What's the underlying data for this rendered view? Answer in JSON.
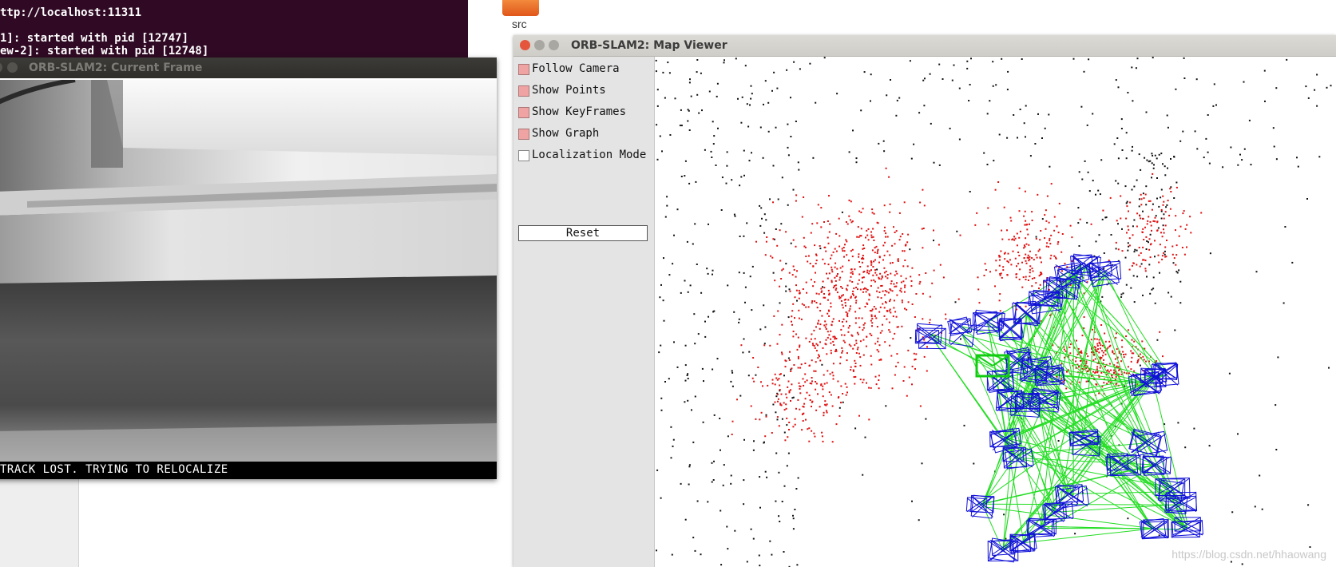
{
  "terminal": {
    "lines": [
      "ttp://localhost:11311",
      "",
      "1]: started with pid [12747]",
      "ew-2]: started with pid [12748]"
    ]
  },
  "desktop": {
    "folder_label": "src"
  },
  "current_frame": {
    "title": "ORB-SLAM2: Current Frame",
    "status": "TRACK LOST. TRYING TO RELOCALIZE"
  },
  "map_viewer": {
    "title": "ORB-SLAM2: Map Viewer",
    "options": [
      {
        "label": "Follow Camera",
        "checked": true
      },
      {
        "label": "Show Points",
        "checked": true
      },
      {
        "label": "Show KeyFrames",
        "checked": true
      },
      {
        "label": "Show Graph",
        "checked": true
      },
      {
        "label": "Localization Mode",
        "checked": false
      }
    ],
    "reset_label": "Reset",
    "watermark": "https://blog.csdn.net/hhaowang"
  },
  "colors": {
    "terminal_bg": "#300a24",
    "map_point_black": "#111111",
    "map_point_red": "#e01010",
    "keyframe_blue": "#1010d8",
    "graph_green": "#22dd22",
    "current_camera_green": "#11cc11",
    "checkbox_on": "#f0a3a3",
    "close_button": "#e5553c"
  },
  "icons": [
    "close-icon",
    "minimize-icon",
    "maximize-icon",
    "folder-icon"
  ]
}
